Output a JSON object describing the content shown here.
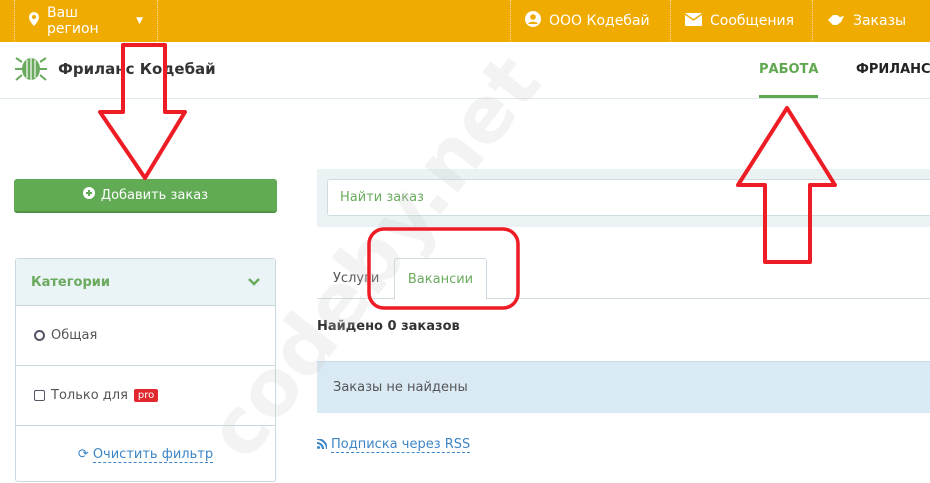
{
  "topbar": {
    "region": "Ваш регион",
    "company": "ООО Кодебай",
    "messages": "Сообщения",
    "orders": "Заказы"
  },
  "header": {
    "logo_text": "Фриланс Кодебай",
    "nav": [
      {
        "label": "РАБОТА",
        "active": true
      },
      {
        "label": "ФРИЛАНС",
        "active": false
      }
    ]
  },
  "sidebar": {
    "add_order": "Добавить заказ",
    "categories": {
      "title": "Категории",
      "items": [
        {
          "label": "Общая",
          "type": "radio"
        },
        {
          "label": "Только для",
          "badge": "pro",
          "type": "checkbox",
          "checked": false
        }
      ],
      "clear_filter": "Очистить фильтр"
    }
  },
  "main": {
    "search_placeholder": "Найти заказ",
    "tabs": [
      {
        "label": "Услуги",
        "active": false
      },
      {
        "label": "Вакансии",
        "active": true
      }
    ],
    "found": "Найдено 0 заказов",
    "empty": "Заказы не найдены",
    "rss": "Подписка через RSS"
  },
  "watermark": "codeby.net",
  "colors": {
    "topbar": "#f0ab00",
    "accent_green": "#62ab55",
    "annotation_red": "#ee1c24",
    "link": "#3d85c6"
  }
}
